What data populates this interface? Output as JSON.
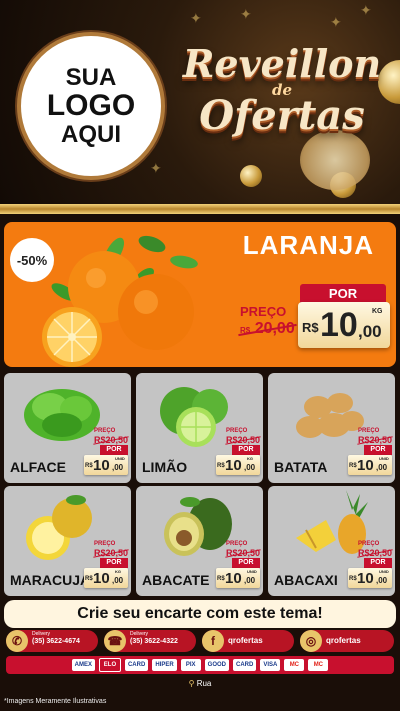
{
  "header": {
    "logo_lines": [
      "SUA",
      "LOGO",
      "AQUI"
    ],
    "title_line1": "Reveillon",
    "title_line2": "de",
    "title_line3": "Ofertas"
  },
  "featured": {
    "discount": "-50%",
    "name": "LARANJA",
    "preco_label": "PREÇO",
    "old_currency": "R$",
    "old_price": "20,00",
    "por_label": "POR",
    "currency": "R$",
    "price_int": "10",
    "price_cents": ",00",
    "unit": "KG"
  },
  "products": [
    {
      "name": "ALFACE",
      "unit": "UNID",
      "preco_label": "PREÇO",
      "old_price": "R$20,50",
      "por_label": "POR",
      "currency": "R$",
      "price_int": "10",
      "price_cents": ",00"
    },
    {
      "name": "LIMÃO",
      "unit": "KG",
      "preco_label": "PREÇO",
      "old_price": "R$20,50",
      "por_label": "POR",
      "currency": "R$",
      "price_int": "10",
      "price_cents": ",00"
    },
    {
      "name": "BATATA",
      "unit": "UNID",
      "preco_label": "PREÇO",
      "old_price": "R$20,50",
      "por_label": "POR",
      "currency": "R$",
      "price_int": "10",
      "price_cents": ",00"
    },
    {
      "name": "MARACUJÁ",
      "unit": "KG",
      "preco_label": "PREÇO",
      "old_price": "R$20,50",
      "por_label": "POR",
      "currency": "R$",
      "price_int": "10",
      "price_cents": ",00"
    },
    {
      "name": "ABACATE",
      "unit": "UNID",
      "preco_label": "PREÇO",
      "old_price": "R$20,50",
      "por_label": "POR",
      "currency": "R$",
      "price_int": "10",
      "price_cents": ",00"
    },
    {
      "name": "ABACAXI",
      "unit": "UNID",
      "preco_label": "PREÇO",
      "old_price": "R$20,50",
      "por_label": "POR",
      "currency": "R$",
      "price_int": "10",
      "price_cents": ",00"
    }
  ],
  "banner_text": "Crie seu encarte com este tema!",
  "contacts": [
    {
      "icon": "whatsapp-icon",
      "label": "Delivery",
      "value": "(35) 3622-4674"
    },
    {
      "icon": "phone-icon",
      "label": "Delivery",
      "value": "(35) 3622-4322"
    },
    {
      "icon": "facebook-icon",
      "label": "",
      "value": "qrofertas"
    },
    {
      "icon": "instagram-icon",
      "label": "",
      "value": "qrofertas"
    }
  ],
  "payments": [
    "AMEX",
    "ELO",
    "CARD",
    "HIPER",
    "PIX",
    "GOOD",
    "CARD",
    "VISA",
    "MC",
    "MC"
  ],
  "address": "Rua",
  "footnote": "*Imagens Meramente Ilustrativas",
  "colors": {
    "orange": "#f47b10",
    "red": "#c8102e",
    "gold": "#e8c46a",
    "dark": "#1a0e08"
  }
}
